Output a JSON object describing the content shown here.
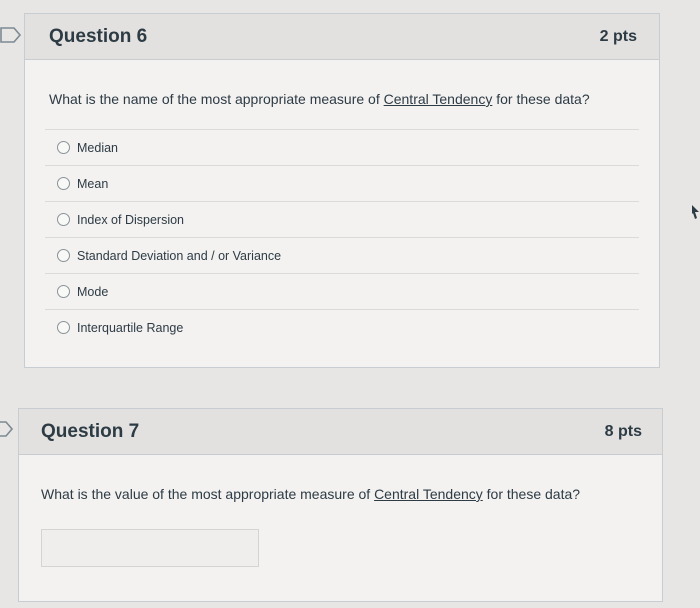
{
  "question6": {
    "title": "Question 6",
    "points": "2 pts",
    "text_before": "What is the name of the most appropriate measure of ",
    "text_link": "Central Tendency",
    "text_after": " for these data?",
    "answers": [
      {
        "label": "Median"
      },
      {
        "label": "Mean"
      },
      {
        "label": "Index of Dispersion"
      },
      {
        "label": "Standard Deviation and / or Variance"
      },
      {
        "label": "Mode"
      },
      {
        "label": "Interquartile Range"
      }
    ]
  },
  "question7": {
    "title": "Question 7",
    "points": "8 pts",
    "text_before": "What is the value of the most appropriate measure of ",
    "text_link": "Central Tendency",
    "text_after": " for these data?",
    "answer_value": ""
  },
  "colors": {
    "background": "#e7e6e4",
    "header": "#e2e1df",
    "text": "#2d3b45",
    "border": "#c7cdd1"
  }
}
